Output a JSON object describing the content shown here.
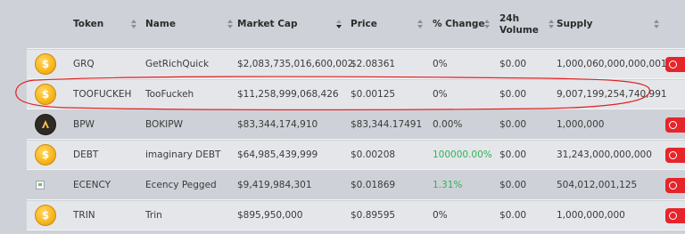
{
  "columns": [
    {
      "key": "token",
      "label": "Token"
    },
    {
      "key": "name",
      "label": "Name"
    },
    {
      "key": "market_cap",
      "label": "Market Cap"
    },
    {
      "key": "price",
      "label": "Price"
    },
    {
      "key": "change",
      "label": "% Change"
    },
    {
      "key": "volume",
      "label": "24h Volume"
    },
    {
      "key": "supply",
      "label": "Supply"
    }
  ],
  "headers": {
    "token": "Token",
    "name": "Name",
    "market_cap": "Market Cap",
    "price": "Price",
    "change": "% Change",
    "volume_line1": "24h",
    "volume_line2": "Volume",
    "supply": "Supply"
  },
  "sort": {
    "column": "market_cap",
    "direction": "descending"
  },
  "rows": [
    {
      "icon": "gold-coin-icon",
      "token": "GRQ",
      "name": "GetRichQuick",
      "market_cap": "$2,083,735,016,600,002",
      "price": "$2.08361",
      "change": "0%",
      "volume": "$0.00",
      "supply": "1,000,060,000,000,001"
    },
    {
      "icon": "gold-coin-icon",
      "token": "TOOFUCKEH",
      "name": "TooFuckeh",
      "market_cap": "$11,258,999,068,426",
      "price": "$0.00125",
      "change": "0%",
      "volume": "$0.00",
      "supply": "9,007,199,254,740,991"
    },
    {
      "icon": "bokipw-logo-icon",
      "token": "BPW",
      "name": "BOKIPW",
      "market_cap": "$83,344,174,910",
      "price": "$83,344.17491",
      "change": "0.00%",
      "volume": "$0.00",
      "supply": "1,000,000"
    },
    {
      "icon": "gold-coin-icon",
      "token": "DEBT",
      "name": "imaginary DEBT",
      "market_cap": "$64,985,439,999",
      "price": "$0.00208",
      "change": "100000.00%",
      "volume": "$0.00",
      "supply": "31,243,000,000,000"
    },
    {
      "icon": "broken-image-icon",
      "token": "ECENCY",
      "name": "Ecency Pegged",
      "market_cap": "$9,419,984,301",
      "price": "$0.01869",
      "change": "1.31%",
      "volume": "$0.00",
      "supply": "504,012,001,125"
    },
    {
      "icon": "gold-coin-icon",
      "token": "TRIN",
      "name": "Trin",
      "market_cap": "$895,950,000",
      "price": "$0.89595",
      "change": "0%",
      "volume": "$0.00",
      "supply": "1,000,000,000"
    }
  ],
  "colors": {
    "positive_change": "#31b356",
    "action_button": "#e5252a",
    "annotation": "#e02020"
  }
}
